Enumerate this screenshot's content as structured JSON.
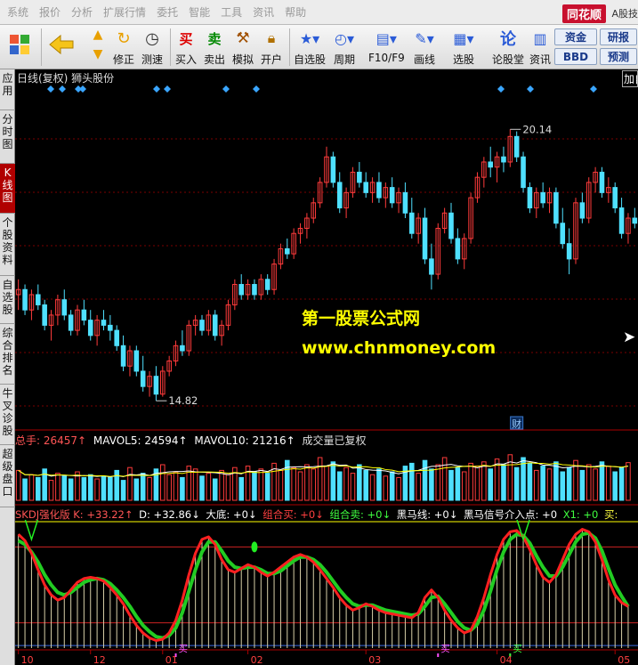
{
  "menu": [
    "系统",
    "报价",
    "分析",
    "扩展行情",
    "委托",
    "智能",
    "工具",
    "资讯",
    "帮助"
  ],
  "brand": "同花顺",
  "brand_side": "A股技",
  "toolbar": {
    "buttons": [
      {
        "label": "修正"
      },
      {
        "label": "测速"
      },
      {
        "label": "买入",
        "glyph": "买"
      },
      {
        "label": "卖出",
        "glyph": "卖"
      },
      {
        "label": "模拟"
      },
      {
        "label": "开户"
      },
      {
        "label": "自选股"
      },
      {
        "label": "周期"
      },
      {
        "label": "F10/F9"
      },
      {
        "label": "画线"
      },
      {
        "label": "选股"
      },
      {
        "label": "论股堂",
        "glyph": "论"
      },
      {
        "label": "资讯"
      }
    ],
    "right_buttons": [
      "资金",
      "研报",
      "BBD",
      "预测"
    ]
  },
  "sidetabs": [
    {
      "label": "应用"
    },
    {
      "label": "分时图"
    },
    {
      "label": "K线图",
      "active": true
    },
    {
      "label": "个股资料"
    },
    {
      "label": "自选股"
    },
    {
      "label": "综合排名"
    },
    {
      "label": "牛叉诊股"
    },
    {
      "label": "超级盘口"
    }
  ],
  "chart_title": "日线(复权)  狮头股份",
  "chart_title_right": "加自",
  "watermark": {
    "line1": "第一股票公式网",
    "line2": "www.chnmoney.com"
  },
  "colors": {
    "up": "#ff3b3b",
    "down": "#4fe0ff",
    "grid": "#7a0000",
    "wm": "#ffff00"
  },
  "chart_data": [
    {
      "type": "candlestick",
      "title": "日线(复权)  狮头股份",
      "high_label": "20.14",
      "low_label": "14.82",
      "finance_marker": "财",
      "ylim": [
        14.3,
        21.0
      ],
      "ohlc": [
        [
          16.9,
          17.2,
          16.6,
          17.0
        ],
        [
          17.0,
          17.1,
          16.5,
          16.6
        ],
        [
          16.6,
          17.0,
          16.4,
          16.9
        ],
        [
          16.9,
          17.1,
          16.6,
          16.7
        ],
        [
          16.7,
          16.8,
          16.2,
          16.3
        ],
        [
          16.3,
          16.6,
          16.0,
          16.5
        ],
        [
          16.5,
          16.9,
          16.3,
          16.8
        ],
        [
          16.8,
          17.0,
          16.4,
          16.5
        ],
        [
          16.5,
          16.6,
          16.1,
          16.2
        ],
        [
          16.2,
          16.7,
          16.1,
          16.6
        ],
        [
          16.6,
          16.8,
          16.3,
          16.4
        ],
        [
          16.4,
          16.6,
          16.0,
          16.1
        ],
        [
          16.1,
          16.5,
          15.9,
          16.4
        ],
        [
          16.4,
          16.6,
          16.2,
          16.3
        ],
        [
          16.3,
          16.5,
          16.0,
          16.2
        ],
        [
          16.2,
          16.3,
          15.8,
          15.9
        ],
        [
          15.9,
          16.1,
          15.4,
          15.5
        ],
        [
          15.5,
          15.9,
          15.3,
          15.8
        ],
        [
          15.8,
          15.9,
          15.3,
          15.4
        ],
        [
          15.4,
          15.7,
          15.0,
          15.1
        ],
        [
          15.1,
          15.4,
          14.9,
          15.3
        ],
        [
          15.3,
          15.5,
          14.82,
          14.95
        ],
        [
          14.95,
          15.5,
          14.9,
          15.4
        ],
        [
          15.4,
          15.7,
          15.3,
          15.6
        ],
        [
          15.6,
          16.0,
          15.5,
          15.9
        ],
        [
          15.9,
          16.2,
          15.7,
          15.8
        ],
        [
          15.8,
          16.4,
          15.7,
          16.3
        ],
        [
          16.3,
          16.5,
          16.1,
          16.4
        ],
        [
          16.4,
          16.5,
          16.1,
          16.2
        ],
        [
          16.2,
          16.6,
          16.1,
          16.5
        ],
        [
          16.5,
          16.6,
          16.0,
          16.1
        ],
        [
          16.1,
          16.4,
          15.9,
          16.3
        ],
        [
          16.3,
          16.8,
          16.2,
          16.7
        ],
        [
          16.7,
          17.2,
          16.6,
          17.1
        ],
        [
          17.1,
          17.3,
          16.8,
          16.9
        ],
        [
          16.9,
          17.2,
          16.8,
          17.1
        ],
        [
          17.1,
          17.2,
          16.8,
          16.9
        ],
        [
          16.9,
          17.3,
          16.8,
          17.2
        ],
        [
          17.2,
          17.3,
          16.9,
          17.0
        ],
        [
          17.0,
          17.6,
          16.9,
          17.5
        ],
        [
          17.5,
          17.9,
          17.4,
          17.8
        ],
        [
          17.8,
          18.0,
          17.6,
          17.7
        ],
        [
          17.7,
          18.2,
          17.6,
          18.1
        ],
        [
          18.1,
          18.3,
          17.9,
          18.2
        ],
        [
          18.2,
          18.5,
          18.0,
          18.4
        ],
        [
          18.4,
          18.8,
          18.3,
          18.7
        ],
        [
          18.7,
          19.2,
          18.6,
          19.1
        ],
        [
          19.1,
          19.8,
          19.0,
          19.6
        ],
        [
          19.6,
          19.7,
          19.0,
          19.1
        ],
        [
          19.1,
          19.3,
          18.5,
          18.6
        ],
        [
          18.6,
          19.0,
          18.4,
          18.9
        ],
        [
          18.9,
          19.4,
          18.8,
          19.3
        ],
        [
          19.3,
          19.5,
          19.0,
          19.1
        ],
        [
          19.1,
          19.3,
          18.8,
          18.9
        ],
        [
          18.9,
          19.2,
          18.7,
          19.1
        ],
        [
          19.1,
          19.3,
          18.7,
          18.8
        ],
        [
          18.8,
          19.1,
          18.6,
          19.0
        ],
        [
          19.0,
          19.2,
          18.6,
          18.7
        ],
        [
          18.7,
          19.0,
          18.5,
          18.9
        ],
        [
          18.9,
          19.1,
          18.4,
          18.5
        ],
        [
          18.5,
          18.8,
          18.0,
          18.1
        ],
        [
          18.1,
          18.5,
          17.9,
          18.4
        ],
        [
          18.4,
          18.6,
          17.5,
          17.6
        ],
        [
          17.6,
          17.9,
          17.0,
          17.3
        ],
        [
          17.3,
          18.3,
          17.2,
          18.2
        ],
        [
          18.2,
          18.6,
          18.1,
          18.5
        ],
        [
          18.5,
          18.7,
          17.9,
          18.0
        ],
        [
          18.0,
          18.2,
          17.5,
          17.6
        ],
        [
          17.6,
          18.1,
          17.4,
          18.0
        ],
        [
          18.0,
          18.9,
          17.9,
          18.8
        ],
        [
          18.8,
          19.3,
          18.7,
          19.2
        ],
        [
          19.2,
          19.6,
          19.0,
          19.5
        ],
        [
          19.5,
          19.8,
          19.2,
          19.4
        ],
        [
          19.4,
          19.7,
          19.1,
          19.6
        ],
        [
          19.6,
          19.8,
          19.3,
          19.5
        ],
        [
          19.5,
          20.14,
          19.4,
          20.0
        ],
        [
          20.0,
          20.1,
          19.5,
          19.6
        ],
        [
          19.6,
          19.7,
          18.9,
          19.0
        ],
        [
          19.0,
          19.1,
          18.5,
          18.6
        ],
        [
          18.6,
          19.0,
          18.4,
          18.9
        ],
        [
          18.9,
          19.1,
          18.6,
          18.7
        ],
        [
          18.7,
          19.0,
          18.5,
          18.9
        ],
        [
          18.9,
          19.0,
          18.2,
          18.3
        ],
        [
          18.3,
          18.6,
          17.8,
          17.9
        ],
        [
          17.9,
          18.2,
          17.3,
          17.6
        ],
        [
          17.6,
          18.8,
          17.5,
          18.7
        ],
        [
          18.7,
          18.9,
          18.3,
          18.4
        ],
        [
          18.4,
          19.2,
          18.3,
          19.1
        ],
        [
          19.1,
          19.4,
          18.9,
          19.3
        ],
        [
          19.3,
          19.4,
          18.8,
          18.9
        ],
        [
          18.9,
          19.2,
          18.7,
          19.0
        ],
        [
          19.0,
          19.1,
          18.5,
          18.6
        ],
        [
          18.6,
          18.8,
          18.0,
          18.1
        ],
        [
          18.1,
          18.5,
          17.9,
          18.4
        ],
        [
          18.4,
          18.6,
          18.2,
          18.3
        ]
      ]
    },
    {
      "type": "bar",
      "title": "总手: 26457↑ MAVOL5: 24594↑ MAVOL10: 21216↑ 成交量已复权",
      "series_labels": [
        "总手: 26457↑",
        "MAVOL5: 24594↑",
        "MAVOL10: 21216↑",
        "成交量已复权"
      ],
      "ylim": [
        0,
        60000
      ],
      "values": [
        21000,
        15000,
        18000,
        16000,
        22000,
        14000,
        19000,
        17000,
        15000,
        20000,
        16000,
        18000,
        15000,
        17000,
        16000,
        21000,
        14000,
        23000,
        15000,
        19000,
        16000,
        22000,
        25000,
        18000,
        20000,
        16000,
        24000,
        22000,
        17000,
        19000,
        15000,
        21000,
        18000,
        23000,
        16000,
        24000,
        20000,
        22000,
        19000,
        26000,
        21000,
        28000,
        23000,
        20000,
        25000,
        22000,
        30000,
        24000,
        27000,
        20000,
        23000,
        19000,
        25000,
        21000,
        18000,
        22000,
        17000,
        20000,
        16000,
        24000,
        26000,
        19000,
        28000,
        22000,
        25000,
        30000,
        21000,
        23000,
        20000,
        26000,
        24000,
        27000,
        22000,
        29000,
        25000,
        32000,
        23000,
        30000,
        26000,
        21000,
        24000,
        22000,
        27000,
        20000,
        23000,
        28000,
        21000,
        25000,
        22000,
        27000,
        24000,
        20000,
        23000,
        26457
      ]
    },
    {
      "type": "line",
      "title": "SKDJ强化版",
      "series_labels": [
        "SKDJ强化版 K: +33.22↑",
        "D: +32.86↓",
        "大底: +0↓",
        "组合买: +0↓",
        "组合卖: +0↓",
        "黑马线: +0↓",
        "黑马信号介入点: +0",
        "X1: +0",
        "买:"
      ],
      "ylim": [
        0,
        100
      ],
      "x_ticks": [
        "10",
        "12",
        "01",
        "02",
        "03",
        "04",
        "05"
      ],
      "buy_label": "买",
      "K": [
        90,
        85,
        75,
        62,
        50,
        42,
        38,
        40,
        46,
        52,
        55,
        56,
        55,
        53,
        48,
        42,
        35,
        26,
        18,
        12,
        8,
        6,
        7,
        12,
        22,
        38,
        58,
        75,
        86,
        88,
        82,
        70,
        62,
        60,
        63,
        66,
        64,
        60,
        57,
        60,
        64,
        68,
        72,
        74,
        72,
        68,
        62,
        55,
        48,
        40,
        34,
        30,
        32,
        35,
        33,
        30,
        28,
        27,
        26,
        25,
        24,
        28,
        40,
        46,
        40,
        30,
        22,
        16,
        12,
        14,
        25,
        40,
        58,
        74,
        86,
        92,
        93,
        88,
        78,
        66,
        56,
        52,
        58,
        70,
        82,
        90,
        94,
        92,
        84,
        70,
        54,
        42,
        36,
        33
      ],
      "D": [
        85,
        82,
        76,
        68,
        58,
        50,
        44,
        42,
        44,
        48,
        52,
        54,
        55,
        54,
        51,
        46,
        40,
        33,
        25,
        18,
        13,
        9,
        8,
        10,
        16,
        28,
        45,
        62,
        76,
        84,
        84,
        77,
        69,
        64,
        63,
        64,
        64,
        62,
        59,
        59,
        61,
        65,
        69,
        72,
        72,
        70,
        66,
        60,
        53,
        46,
        40,
        35,
        33,
        34,
        34,
        32,
        30,
        29,
        28,
        27,
        26,
        27,
        33,
        40,
        41,
        35,
        28,
        21,
        16,
        14,
        19,
        30,
        45,
        62,
        76,
        86,
        90,
        89,
        83,
        73,
        64,
        57,
        57,
        64,
        74,
        84,
        90,
        91,
        87,
        77,
        63,
        50,
        41,
        32.86
      ]
    }
  ]
}
